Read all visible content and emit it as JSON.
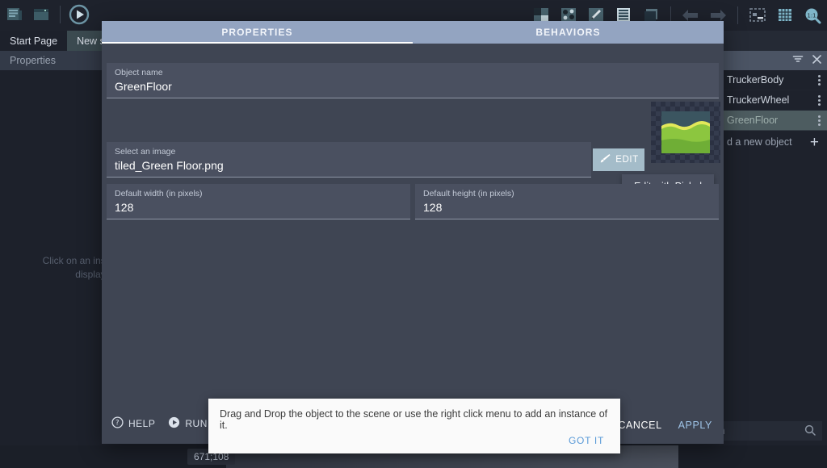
{
  "toolbar": {
    "left_icons": [
      {
        "name": "project-manager-icon",
        "title": "Project manager"
      },
      {
        "name": "scene-editor-icon",
        "title": "Scene editor"
      },
      {
        "name": "play-preview-icon",
        "title": "Preview"
      }
    ],
    "right_icons": [
      {
        "name": "move-objects-icon"
      },
      {
        "name": "scatter-objects-icon"
      },
      {
        "name": "edit-object-icon"
      },
      {
        "name": "object-list-icon"
      },
      {
        "name": "layers-icon"
      },
      {
        "name": "undo-icon"
      },
      {
        "name": "redo-icon"
      },
      {
        "name": "window-mask-icon"
      },
      {
        "name": "grid-icon"
      },
      {
        "name": "zoom-reset-icon",
        "label": "1:1"
      }
    ]
  },
  "tabs": [
    {
      "label": "Start Page",
      "state": "inactive"
    },
    {
      "label": "New scene",
      "state": "active"
    }
  ],
  "panel": {
    "title": "Properties"
  },
  "scene": {
    "hint_line1": "Click on an instance",
    "hint_line2": "display its pr",
    "coordinates": "671;108"
  },
  "objects_panel": {
    "header_icons": [
      "filter-icon",
      "close-icon"
    ],
    "items": [
      {
        "label": "TruckerBody",
        "selected": false
      },
      {
        "label": "TruckerWheel",
        "selected": false
      },
      {
        "label": "GreenFloor",
        "selected": true
      }
    ],
    "add_label": "d a new object",
    "add_icon": "plus-icon",
    "search_placeholder": "Search",
    "search_icon": "search-icon"
  },
  "dialog": {
    "tabs": [
      {
        "label": "PROPERTIES",
        "active": true
      },
      {
        "label": "BEHAVIORS",
        "active": false
      }
    ],
    "fields": {
      "object_name": {
        "label": "Object name",
        "value": "GreenFloor"
      },
      "image": {
        "label": "Select an image",
        "value": "tiled_Green Floor.png"
      },
      "width": {
        "label": "Default width (in pixels)",
        "value": "128"
      },
      "height": {
        "label": "Default height (in pixels)",
        "value": "128"
      }
    },
    "edit_button": {
      "label": "EDIT",
      "icon": "brush-icon"
    },
    "tooltip": "Edit with Piskel",
    "thumbnail": {
      "name": "green-floor-preview",
      "sky_color": "#3b5560",
      "grass_light": "#e2e85a",
      "grass_mid": "#8cc63f",
      "grass_dark": "#6fae36"
    },
    "footer": {
      "help_label": "HELP",
      "help_icon": "question-circle-icon",
      "run_label": "RUN A P",
      "run_icon": "play-circle-icon",
      "cancel_label": "CANCEL",
      "apply_label": "APPLY"
    }
  },
  "snackbar": {
    "message": "Drag and Drop the object to the scene or use the right click menu to add an instance of it.",
    "action": "GOT IT"
  },
  "colors": {
    "accent": "#93a4c1",
    "apply": "#9fc4e8",
    "dialog_bg": "#3f4553",
    "field_bg": "#4a5060"
  }
}
